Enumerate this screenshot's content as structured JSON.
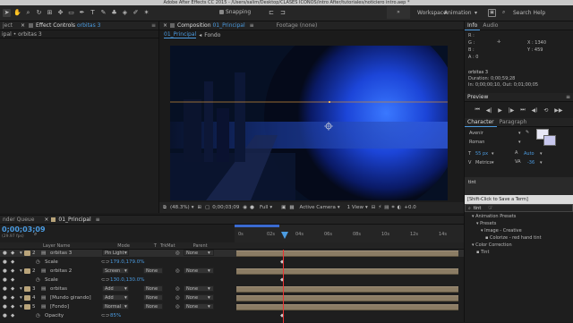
{
  "window_title": "Adobe After Effects CC 2015 - /Users/salim/Desktop/CLASES ICONOS/intro After/tutoriales/noticiero intro.aep *",
  "toolbar": {
    "snapping": "Snapping",
    "workspace_label": "Workspace:",
    "workspace_value": "Animation",
    "search_help": "Search Help"
  },
  "left_panel": {
    "tab_project": "ject",
    "tab_effect_controls_prefix": "Effect Controls",
    "tab_effect_controls_layer": "orbitas 3",
    "breadcrumb": "ipal • orbitas 3"
  },
  "composition": {
    "tab_prefix": "Composition",
    "tab_comp_name": "01_Principal",
    "footage_tab": "Footage (none)",
    "nav_comp": "01_Principal",
    "nav_sep": "◂",
    "nav_fondo": "Fondo",
    "zoom": "(48.3%)",
    "timecode": "0;00;03;09",
    "resolution": "Full",
    "camera": "Active Camera",
    "view": "1 View",
    "offset": "+0.0"
  },
  "info": {
    "tab_info": "Info",
    "tab_audio": "Audio",
    "r": "R :",
    "g": "G :",
    "b": "B :",
    "a": "A : 0",
    "x": "X : 1340",
    "y": "Y : 459",
    "layer_name": "orbitas 3",
    "duration": "Duration: 0;00;59;28",
    "in_out": "In: 0;00;00;10, Out: 0;01;00;05"
  },
  "preview": {
    "title": "Preview"
  },
  "character": {
    "tab_character": "Character",
    "tab_paragraph": "Paragraph",
    "font": "Avenir",
    "style": "Roman",
    "size": "55 px",
    "leading": "Auto",
    "metrics": "Metrics",
    "tracking": "-36"
  },
  "effects": {
    "search_value": "tint",
    "tooltip": "[Shift-Click to Save a Term]",
    "search_value2": "tint",
    "tree": [
      {
        "label": "Animation Presets",
        "indent": 1
      },
      {
        "label": "Presets",
        "indent": 2
      },
      {
        "label": "Image - Creative",
        "indent": 3
      },
      {
        "label": "Colorize - red hand tint",
        "indent": 4
      },
      {
        "label": "Color Correction",
        "indent": 1
      },
      {
        "label": "Tint",
        "indent": 2
      }
    ]
  },
  "timeline": {
    "tab_render": "nder Queue",
    "tab_comp": "01_Principal",
    "timecode": "0;00;03;09",
    "fps": "(29.97 fps)",
    "col_layer_name": "Layer Name",
    "col_mode": "Mode",
    "col_t": "T",
    "col_trkmat": "TrkMat",
    "col_parent": "Parent",
    "ruler": [
      "0s",
      "02s",
      "04s",
      "06s",
      "08s",
      "10s",
      "12s",
      "14s"
    ],
    "layers": [
      {
        "num": "2",
        "name": "orbitas 3",
        "mode": "Pin Light",
        "trk": "",
        "parent": "None",
        "color": "#b9a47a",
        "selected": true
      },
      {
        "sub": "Scale",
        "value": "179.0,179.0%"
      },
      {
        "num": "2",
        "name": "orbitas 2",
        "mode": "Screen",
        "trk": "None",
        "parent": "None",
        "color": "#b9a47a"
      },
      {
        "sub": "Scale",
        "value": "130.0,130.0%"
      },
      {
        "num": "3",
        "name": "orbitas",
        "mode": "Add",
        "trk": "None",
        "parent": "None",
        "color": "#b9a47a"
      },
      {
        "num": "4",
        "name": "[Mundo girando]",
        "mode": "Add",
        "trk": "None",
        "parent": "None",
        "color": "#b9a47a"
      },
      {
        "num": "5",
        "name": "[Fondo]",
        "mode": "Normal",
        "trk": "None",
        "parent": "None",
        "color": "#b9a47a"
      },
      {
        "sub": "Opacity",
        "value": "85%"
      }
    ]
  }
}
